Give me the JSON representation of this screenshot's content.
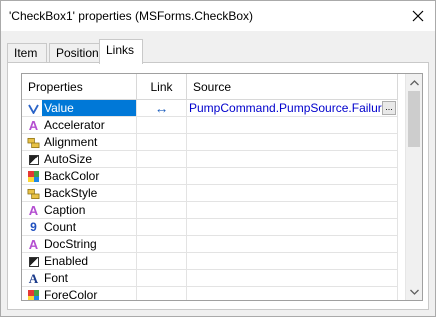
{
  "window": {
    "title": "'CheckBox1' properties (MSForms.CheckBox)"
  },
  "tabs": [
    {
      "label": "Item"
    },
    {
      "label": "Position"
    },
    {
      "label": "Links",
      "active": true
    }
  ],
  "grid": {
    "columns": {
      "properties": "Properties",
      "link": "Link",
      "source": "Source"
    },
    "rows": [
      {
        "icon": "variable-icon",
        "label": "Value",
        "link": "↔",
        "source": "PumpCommand.PumpSource.Failure",
        "selected": true
      },
      {
        "icon": "text-a-icon",
        "label": "Accelerator",
        "link": "",
        "source": ""
      },
      {
        "icon": "alignment-icon",
        "label": "Alignment",
        "link": "",
        "source": ""
      },
      {
        "icon": "boolean-icon",
        "label": "AutoSize",
        "link": "",
        "source": ""
      },
      {
        "icon": "color-icon",
        "label": "BackColor",
        "link": "",
        "source": ""
      },
      {
        "icon": "style-icon",
        "label": "BackStyle",
        "link": "",
        "source": ""
      },
      {
        "icon": "text-a-icon",
        "label": "Caption",
        "link": "",
        "source": ""
      },
      {
        "icon": "number-icon",
        "label": "Count",
        "link": "",
        "source": ""
      },
      {
        "icon": "text-a-icon",
        "label": "DocString",
        "link": "",
        "source": ""
      },
      {
        "icon": "boolean-icon",
        "label": "Enabled",
        "link": "",
        "source": ""
      },
      {
        "icon": "font-icon",
        "label": "Font",
        "link": "",
        "source": ""
      },
      {
        "icon": "color-icon",
        "label": "ForeColor",
        "link": "",
        "source": ""
      }
    ],
    "ellipsis_label": "..."
  },
  "colors": {
    "selection": "#0078d7",
    "source_text": "#0000cc",
    "link_arrow": "#1f5fbf",
    "text_a_icon": "#b44fd1"
  }
}
